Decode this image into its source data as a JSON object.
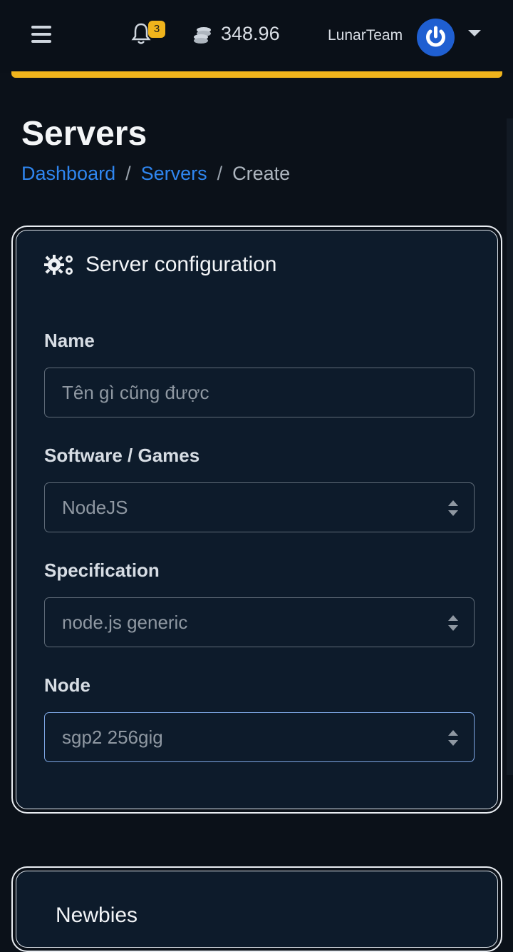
{
  "header": {
    "notification_count": "3",
    "balance": "348.96",
    "username": "LunarTeam",
    "accent_color": "#f0b41c",
    "avatar_color": "#1f5fd1"
  },
  "page": {
    "title": "Servers",
    "breadcrumb": {
      "dashboard": "Dashboard",
      "servers": "Servers",
      "current": "Create",
      "separator": "/"
    }
  },
  "config_card": {
    "title": "Server configuration",
    "icon": "cogs-icon",
    "fields": {
      "name": {
        "label": "Name",
        "placeholder": "Tên gì cũng được"
      },
      "software": {
        "label": "Software / Games",
        "value": "NodeJS"
      },
      "specification": {
        "label": "Specification",
        "value": "node.js generic"
      },
      "node": {
        "label": "Node",
        "value": "sgp2 256gig"
      }
    }
  },
  "plan_card": {
    "title": "Newbies"
  }
}
